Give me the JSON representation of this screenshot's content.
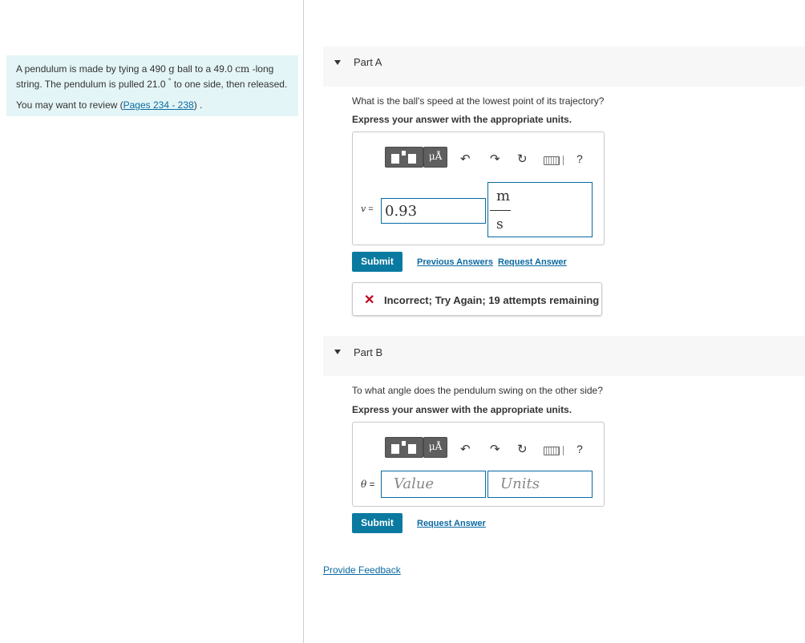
{
  "problem": {
    "line1_pre": "A pendulum is made by tying a 490 ",
    "mass_unit": "g",
    "line1_mid": " ball to a 49.0 ",
    "length_unit": "cm",
    "line1_post": " -long",
    "line2_pre": "string. The pendulum is pulled 21.0 ",
    "degree": "°",
    "line2_post": " to one side, then released.",
    "review_pre": "You may want to review (",
    "review_link": "Pages 234 - 238",
    "review_post": ") ."
  },
  "partA": {
    "label": "Part A",
    "question": "What is the ball's speed at the lowest point of its trajectory?",
    "express": "Express your answer with the appropriate units.",
    "toolbar": {
      "mu_label": "μÅ",
      "help": "?"
    },
    "variable": "v",
    "equals": " =",
    "value": "0.93",
    "unit_numerator": "m",
    "unit_denominator": "s",
    "submit_label": "Submit",
    "previous_answers": "Previous Answers",
    "request_answer": "Request Answer",
    "feedback_icon": "✕",
    "feedback_message": "Incorrect; Try Again; 19 attempts remaining"
  },
  "partB": {
    "label": "Part B",
    "question": "To what angle does the pendulum swing on the other side?",
    "express": "Express your answer with the appropriate units.",
    "toolbar": {
      "mu_label": "μÅ",
      "help": "?"
    },
    "variable": "θ",
    "equals": " =",
    "value_placeholder": "Value",
    "units_placeholder": "Units",
    "submit_label": "Submit",
    "request_answer": "Request Answer"
  },
  "footer": {
    "provide_feedback": "Provide Feedback"
  },
  "colors": {
    "accent": "#0a7aa0",
    "link": "#0a6aa1",
    "error": "#c0001b",
    "problem_bg": "#e4f5f7"
  }
}
